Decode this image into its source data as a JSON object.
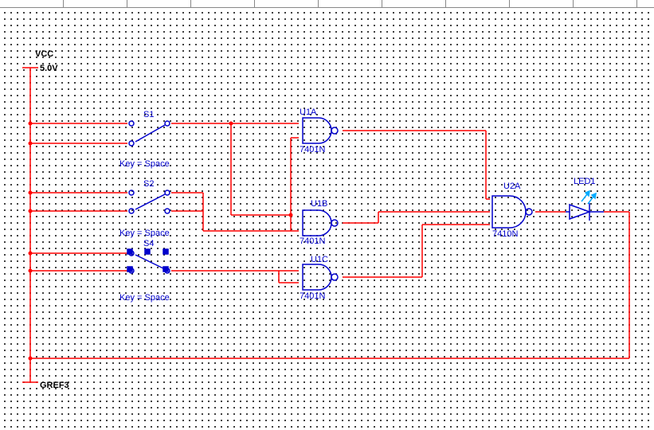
{
  "power": {
    "vcc_label": "VCC",
    "vcc_value": "5.0V",
    "gnd_label": "GREF3"
  },
  "switches": {
    "s1": {
      "name": "S1",
      "key_label": "Key = Space"
    },
    "s2": {
      "name": "S2",
      "key_label": "Key = Space"
    },
    "s4": {
      "name": "S4",
      "key_label": "Key = Space"
    }
  },
  "gates": {
    "u1a": {
      "name": "U1A",
      "part": "7401N"
    },
    "u1b": {
      "name": "U1B",
      "part": "7401N"
    },
    "u1c": {
      "name": "U1C",
      "part": "7401N"
    },
    "u2a": {
      "name": "U2A",
      "part": "7410N"
    }
  },
  "led": {
    "name": "LED1"
  }
}
